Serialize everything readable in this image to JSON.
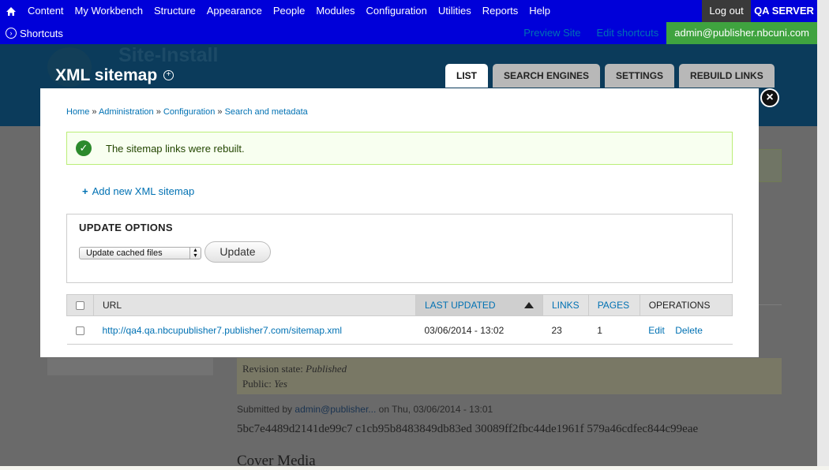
{
  "toolbar": {
    "items": [
      "Content",
      "My Workbench",
      "Structure",
      "Appearance",
      "People",
      "Modules",
      "Configuration",
      "Utilities",
      "Reports",
      "Help"
    ],
    "logout": "Log out",
    "server": "QA SERVER"
  },
  "shortcuts": {
    "label": "Shortcuts",
    "preview": "Preview Site",
    "edit": "Edit shortcuts",
    "user": "admin@publisher.nbcuni.com"
  },
  "header": {
    "site_name": "Site-Install",
    "title": "XML sitemap",
    "tabs": [
      "LIST",
      "SEARCH ENGINES",
      "SETTINGS",
      "REBUILD LINKS"
    ]
  },
  "modal": {
    "breadcrumb": [
      "Home",
      "Administration",
      "Configuration",
      "Search and metadata"
    ],
    "status": "The sitemap links were rebuilt.",
    "add_link": "Add new XML sitemap",
    "update": {
      "legend": "UPDATE OPTIONS",
      "selected": "Update cached files",
      "button": "Update"
    },
    "table": {
      "headers": {
        "url": "URL",
        "last_updated": "LAST UPDATED",
        "links": "LINKS",
        "pages": "PAGES",
        "operations": "OPERATIONS"
      },
      "rows": [
        {
          "url": "http://qa4.qa.nbcupublisher7.publisher7.com/sitemap.xml",
          "last_updated": "03/06/2014 - 13:02",
          "links": "23",
          "pages": "1",
          "edit": "Edit",
          "delete": "Delete"
        }
      ]
    }
  },
  "background": {
    "revision_label": "Revision state:",
    "revision_value": "Published",
    "public_label": "Public:",
    "public_value": "Yes",
    "submitted_by": "Submitted by",
    "submitted_user": "admin@publisher...",
    "submitted_on": "on Thu, 03/06/2014 - 13:01",
    "hash": "5bc7e4489d2141de99c7 c1cb95b8483849db83ed 30089ff2fbc44de1961f 579a46cdfec844c99eae",
    "cover": "Cover Media"
  }
}
